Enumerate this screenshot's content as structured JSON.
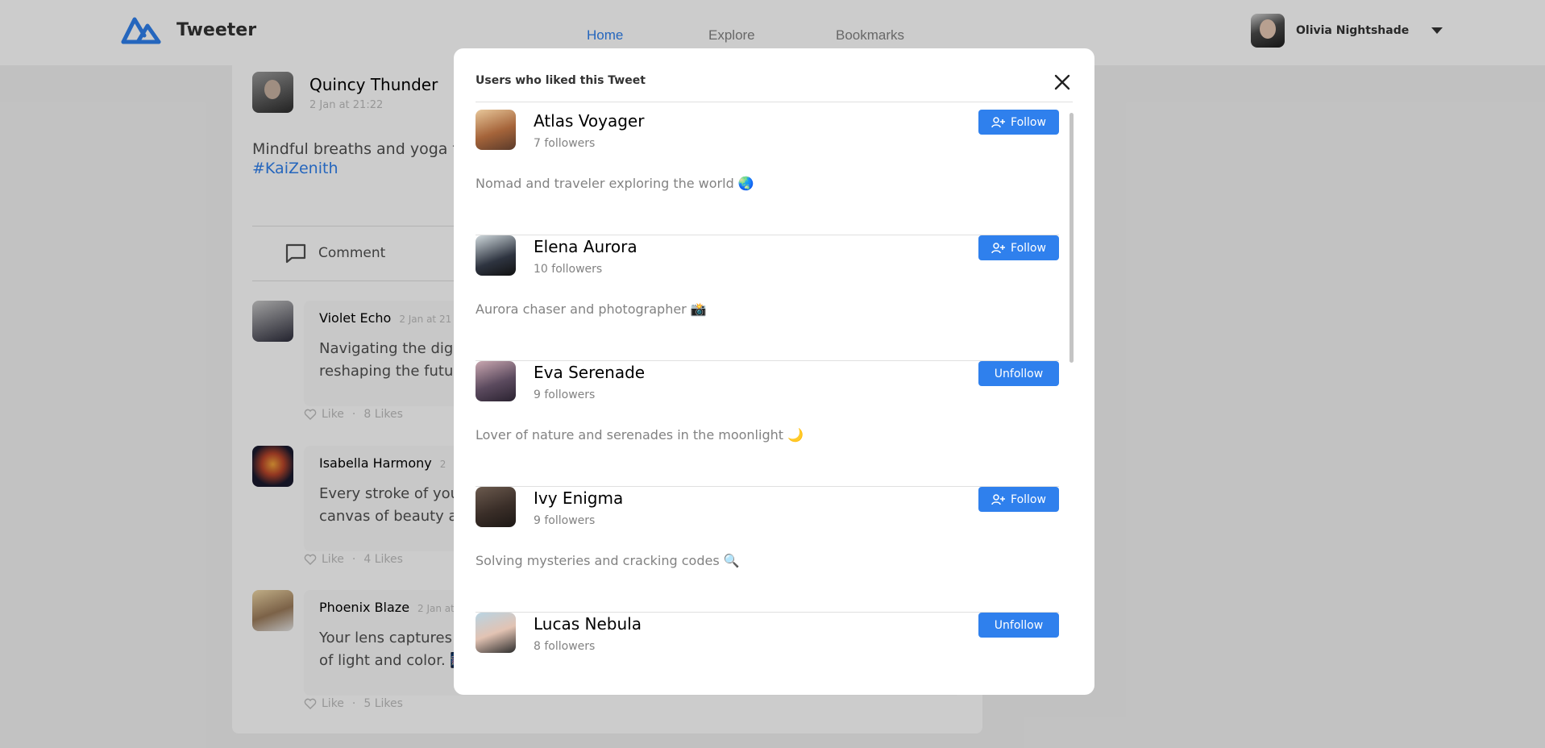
{
  "navbar": {
    "brand": "Tweeter",
    "links": [
      "Home",
      "Explore",
      "Bookmarks"
    ],
    "active_link": "Home",
    "user_name": "Olivia Nightshade"
  },
  "post": {
    "author": "Quincy Thunder",
    "time": "2 Jan at 21:22",
    "text": "Mindful breaths and yoga flo",
    "hashtag": "#KaiZenith",
    "comment_label": "Comment"
  },
  "comments": [
    {
      "author": "Violet Echo",
      "time": "2 Jan at 21",
      "text_line1": "Navigating the digit",
      "text_line2": "reshaping the futur",
      "like_label": "Like",
      "likes": "8 Likes"
    },
    {
      "author": "Isabella Harmony",
      "time": "2",
      "text_line1": "Every stroke of your",
      "text_line2": "canvas of beauty an",
      "like_label": "Like",
      "likes": "4 Likes"
    },
    {
      "author": "Phoenix Blaze",
      "time": "2 Jan at",
      "text_line1": "Your lens captures t",
      "text_line2": "of light and color. 🎆",
      "like_label": "Like",
      "likes": "5 Likes"
    }
  ],
  "modal": {
    "title": "Users who liked this Tweet",
    "users": [
      {
        "name": "Atlas Voyager",
        "followers": "7 followers",
        "bio": "Nomad and traveler exploring the world 🌏",
        "button": "Follow",
        "following": false
      },
      {
        "name": "Elena Aurora",
        "followers": "10 followers",
        "bio": "Aurora chaser and photographer 📸",
        "button": "Follow",
        "following": false
      },
      {
        "name": "Eva Serenade",
        "followers": "9 followers",
        "bio": "Lover of nature and serenades in the moonlight 🌙",
        "button": "Unfollow",
        "following": true
      },
      {
        "name": "Ivy Enigma",
        "followers": "9 followers",
        "bio": "Solving mysteries and cracking codes 🔍",
        "button": "Follow",
        "following": false
      },
      {
        "name": "Lucas Nebula",
        "followers": "8 followers",
        "bio": "",
        "button": "Unfollow",
        "following": true
      }
    ]
  },
  "colors": {
    "accent": "#2F80ED",
    "overlay": "rgba(0,0,0,0.2)"
  }
}
